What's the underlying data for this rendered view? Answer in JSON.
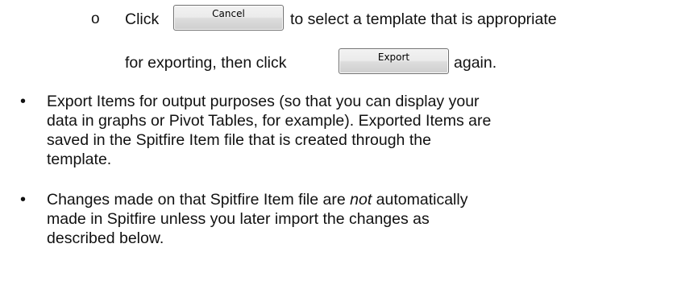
{
  "sub_bullet": {
    "marker": "o",
    "line1_before": "Click",
    "cancel_button_label": "Cancel",
    "line1_after": "to select a template that is appropriate",
    "line2_before": "for exporting, then click",
    "export_button_label": "Export",
    "line2_after": "again."
  },
  "bullets": [
    {
      "marker": "•",
      "lines": [
        "Export Items for output purposes (so that you can display your",
        "data in graphs or Pivot Tables, for example).  Exported Items are",
        "saved in the Spitfire Item file that is created through the",
        "template."
      ]
    },
    {
      "marker": "•",
      "line1_before": "Changes made on that Spitfire Item file are ",
      "line1_emphasis": "not",
      "line1_after": " automatically",
      "lines_rest": [
        "made in Spitfire unless you later import the changes as",
        "described below."
      ]
    }
  ]
}
